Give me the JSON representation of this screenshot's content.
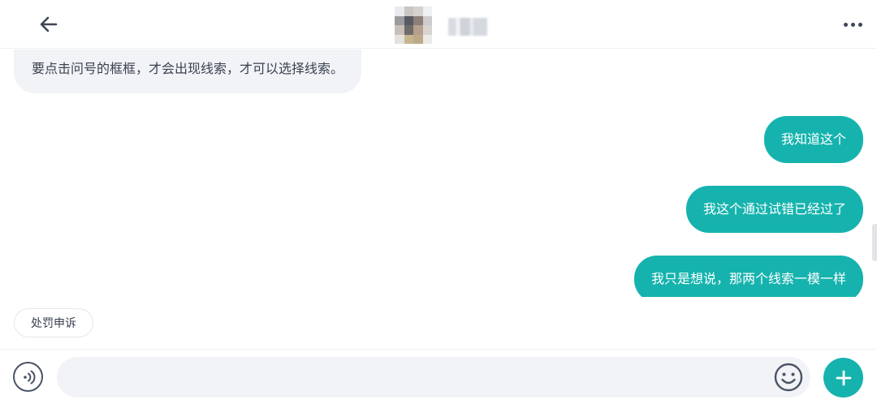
{
  "header": {
    "back_icon": "arrow-left-icon",
    "avatar_icon": "avatar-pixelated",
    "contact_name": "",
    "more_icon": "more-horizontal-icon"
  },
  "messages": [
    {
      "side": "received",
      "text": "要点击问号的框框，才会出现线索，才可以选择线索。"
    },
    {
      "side": "sent",
      "text": "我知道这个"
    },
    {
      "side": "sent",
      "text": "我这个通过试错已经过了"
    },
    {
      "side": "sent",
      "text": "我只是想说，那两个线索一模一样"
    }
  ],
  "quick_action": {
    "label": "处罚申诉"
  },
  "composer": {
    "voice_icon": "voice-icon",
    "input_value": "",
    "input_placeholder": "",
    "emoji_icon": "emoji-smile-icon",
    "plus_icon": "plus-icon"
  },
  "colors": {
    "accent": "#16b3ae",
    "received_bubble": "#f1f3f6",
    "text_dark": "#3a4150",
    "icon_dark": "#4a5366"
  }
}
